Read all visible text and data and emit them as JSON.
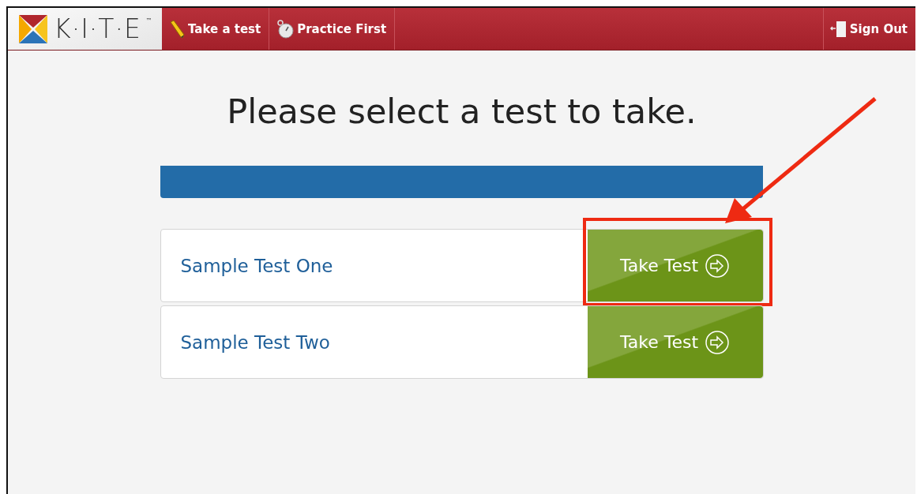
{
  "logo": {
    "text": "K·I·T·E",
    "mark": "™"
  },
  "nav": [
    {
      "label": "Take a test",
      "kind": "pencil"
    },
    {
      "label": "Practice First",
      "kind": "stopwatch"
    }
  ],
  "sign_out": {
    "label": "Sign Out"
  },
  "heading": "Please select a test to take.",
  "tests": [
    {
      "name": "Sample Test One",
      "button": "Take Test",
      "highlighted": true
    },
    {
      "name": "Sample Test Two",
      "button": "Take Test",
      "highlighted": false
    }
  ]
}
